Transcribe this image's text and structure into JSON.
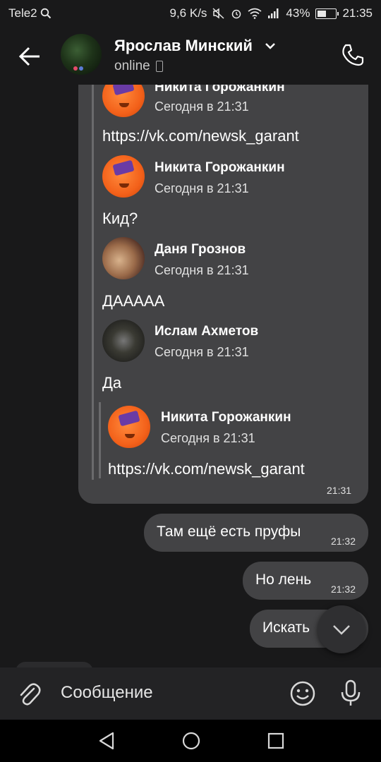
{
  "status_bar": {
    "carrier": "Tele2",
    "speed": "9,6 K/s",
    "battery": "43%",
    "time": "21:35"
  },
  "header": {
    "contact_name": "Ярослав Минский",
    "status": "online"
  },
  "forwarded": [
    {
      "author": "Никита Горожанкин",
      "when": "Сегодня в 21:31",
      "text": "https://vk.com/newsk_garant"
    },
    {
      "author": "Никита Горожанкин",
      "when": "Сегодня в 21:31",
      "text": "Кид?"
    },
    {
      "author": "Даня Грознов",
      "when": "Сегодня в 21:31",
      "text": "ДААААА"
    },
    {
      "author": "Ислам Ахметов",
      "when": "Сегодня в 21:31",
      "text": "Да"
    },
    {
      "author": "Никита Горожанкин",
      "when": "Сегодня в 21:31",
      "text": "https://vk.com/newsk_garant"
    }
  ],
  "big_bubble_time": "21:31",
  "messages": [
    {
      "text": "Там ещё есть пруфы",
      "time": "21:32"
    },
    {
      "text": "Но лень",
      "time": "21:32"
    },
    {
      "text": "Искать",
      "time": ""
    }
  ],
  "input": {
    "placeholder": "Сообщение"
  },
  "icons": [
    "back-arrow-icon",
    "chevron-down-icon",
    "phone-icon",
    "attach-icon",
    "emoji-icon",
    "mic-icon",
    "scroll-down-icon",
    "nav-back-icon",
    "nav-home-icon",
    "nav-recent-icon"
  ],
  "colors": {
    "background": "#19191a",
    "bubble": "#434345",
    "input_bar": "#232325"
  }
}
